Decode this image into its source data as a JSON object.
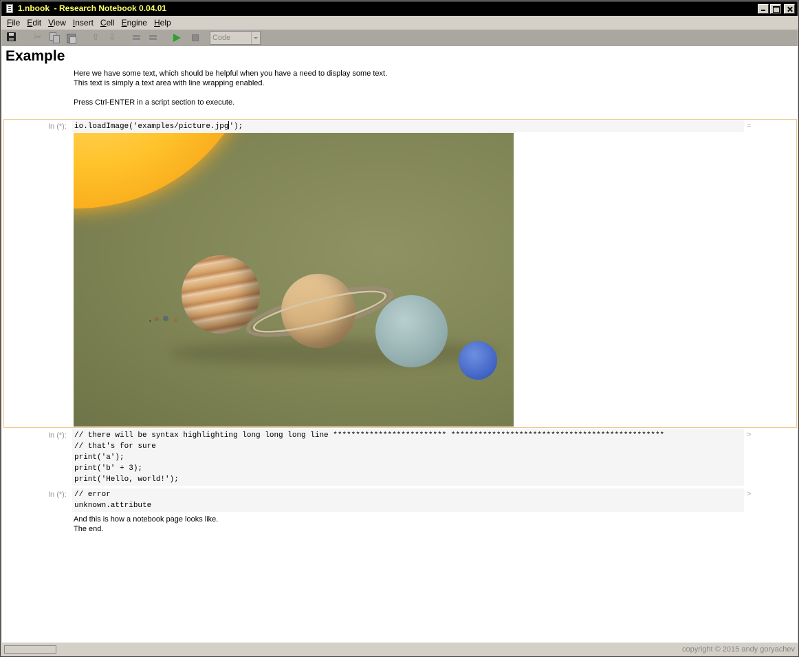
{
  "window": {
    "title": "1.nbook  - Research Notebook 0.04.01"
  },
  "menu": [
    {
      "key": "F",
      "rest": "ile"
    },
    {
      "key": "E",
      "rest": "dit"
    },
    {
      "key": "V",
      "rest": "iew"
    },
    {
      "key": "I",
      "rest": "nsert"
    },
    {
      "key": "C",
      "rest": "ell"
    },
    {
      "key": "E",
      "rest": "ngine"
    },
    {
      "key": "H",
      "rest": "elp"
    }
  ],
  "toolbar": {
    "cell_type": "Code",
    "icons": [
      "save-icon",
      "cut-icon",
      "copy-icon",
      "paste-icon",
      "arrow-up-icon",
      "arrow-down-icon",
      "cell-up-icon",
      "cell-down-icon",
      "run-icon",
      "stop-icon"
    ]
  },
  "notebook": {
    "heading": "Example",
    "intro": "Here we have some text, which should be helpful when you have a need to display some text.\nThis text is simply a text area with line wrapping enabled.\n\nPress Ctrl-ENTER in a script section to execute.",
    "cells": [
      {
        "prompt": "In (*):",
        "code_before_caret": "io.loadImage('examples/picture.jpg",
        "code_after_caret": "');",
        "marker": "="
      },
      {
        "prompt": "In (*):",
        "code": "// there will be syntax highlighting long long long line ************************* ***********************************************\n// that's for sure\nprint('a');\nprint('b' + 3);\nprint('Hello, world!');",
        "marker": ">"
      },
      {
        "prompt": "In (*):",
        "code": "// error\nunknown.attribute",
        "marker": ">"
      }
    ],
    "closing_text": "And this is how a notebook page looks like.\nThe end."
  },
  "status": {
    "copyright": "copyright © 2015 andy goryachev"
  }
}
